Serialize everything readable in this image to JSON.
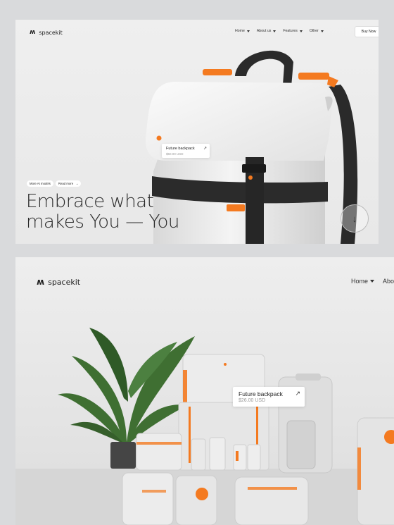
{
  "colors": {
    "accent": "#f47a20",
    "background": "#e9e9e9",
    "ink": "#1d1d1d"
  },
  "card1": {
    "logo": {
      "mark": "ʍ",
      "name": "spacekit"
    },
    "nav": [
      {
        "label": "Home",
        "icon": "chevron-down-icon"
      },
      {
        "label": "About us",
        "icon": "chevron-down-icon"
      },
      {
        "label": "Features",
        "icon": "chevron-down-icon"
      },
      {
        "label": "Other",
        "icon": "chevron-down-icon"
      }
    ],
    "cta": "Buy Now",
    "pills": [
      {
        "label": "More AI models"
      },
      {
        "label": "Read more",
        "icon": "arrow-right-icon"
      }
    ],
    "headline": [
      "Embrace what",
      "makes You — You"
    ],
    "product_tag": {
      "name": "Future backpack",
      "price": "$50.00 USD"
    },
    "scroll_badge": {
      "icon": "arrow-down-icon"
    }
  },
  "card2": {
    "logo": {
      "mark": "ʍ",
      "name": "spacekit"
    },
    "nav": [
      {
        "label": "Home",
        "icon": "chevron-down-icon"
      },
      {
        "label": "Abo",
        "icon": ""
      }
    ],
    "product_tag": {
      "name": "Future backpack",
      "price": "$26.00 USD"
    }
  }
}
